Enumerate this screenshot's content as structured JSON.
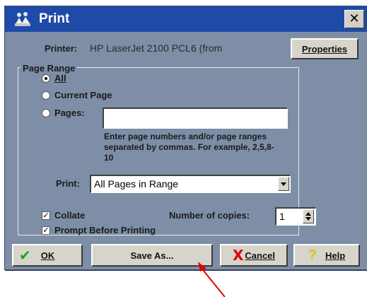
{
  "window": {
    "title": "Print",
    "close_label": "✕"
  },
  "printer": {
    "label": "Printer:",
    "name": "HP LaserJet 2100 PCL6 (from",
    "properties_label": "Properties"
  },
  "page_range": {
    "title": "Page Range",
    "options": [
      {
        "label": "All",
        "checked": true
      },
      {
        "label": "Current Page",
        "checked": false
      },
      {
        "label": "Pages:",
        "checked": false
      }
    ],
    "pages_value": "",
    "hint": "Enter page numbers and/or page ranges separated by commas. For example, 2,5,8-10",
    "print_label": "Print:",
    "print_value": "All Pages in Range"
  },
  "options": {
    "collate_label": "Collate",
    "collate_checked": true,
    "prompt_label": "Prompt Before Printing",
    "prompt_checked": true,
    "copies_label": "Number of copies:",
    "copies_value": "1"
  },
  "buttons": {
    "ok": "OK",
    "save_as": "Save As...",
    "cancel": "Cancel",
    "help": "Help"
  },
  "colors": {
    "dialog_bg": "#7d8ea6",
    "titlebar": "#1f4aa8",
    "annotation_arrow": "#e00000"
  }
}
